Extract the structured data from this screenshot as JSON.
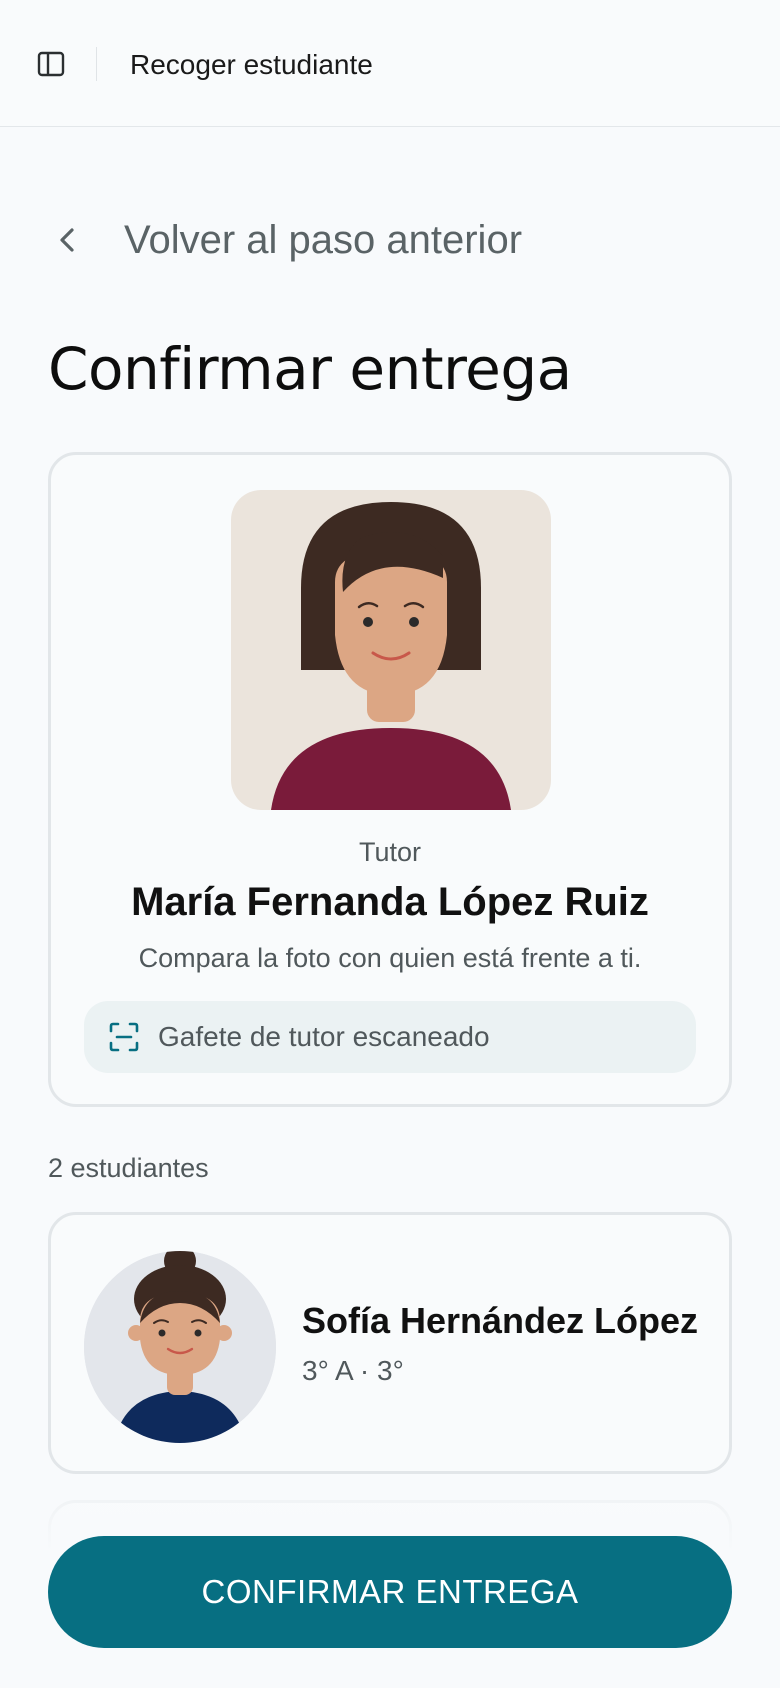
{
  "header": {
    "title": "Recoger estudiante",
    "sidebar_icon": "sidebar-panel-icon"
  },
  "back": {
    "label": "Volver al paso anterior",
    "icon": "chevron-left-icon"
  },
  "page": {
    "title": "Confirmar entrega"
  },
  "tutor": {
    "role": "Tutor",
    "name": "María Fernanda López Ruiz",
    "hint": "Compara la foto con quien está frente a ti.",
    "badge_label": "Gafete de tutor escaneado",
    "badge_icon": "scan-icon"
  },
  "students": {
    "count_label": "2 estudiantes",
    "items": [
      {
        "name": "Sofía Hernández López",
        "grade": "3° A · 3°"
      }
    ]
  },
  "actions": {
    "confirm_label": "CONFIRMAR ENTREGA"
  },
  "colors": {
    "accent": "#076f82",
    "background": "#f8fafc",
    "border": "#e2e6e9",
    "muted_text": "#50585b"
  }
}
